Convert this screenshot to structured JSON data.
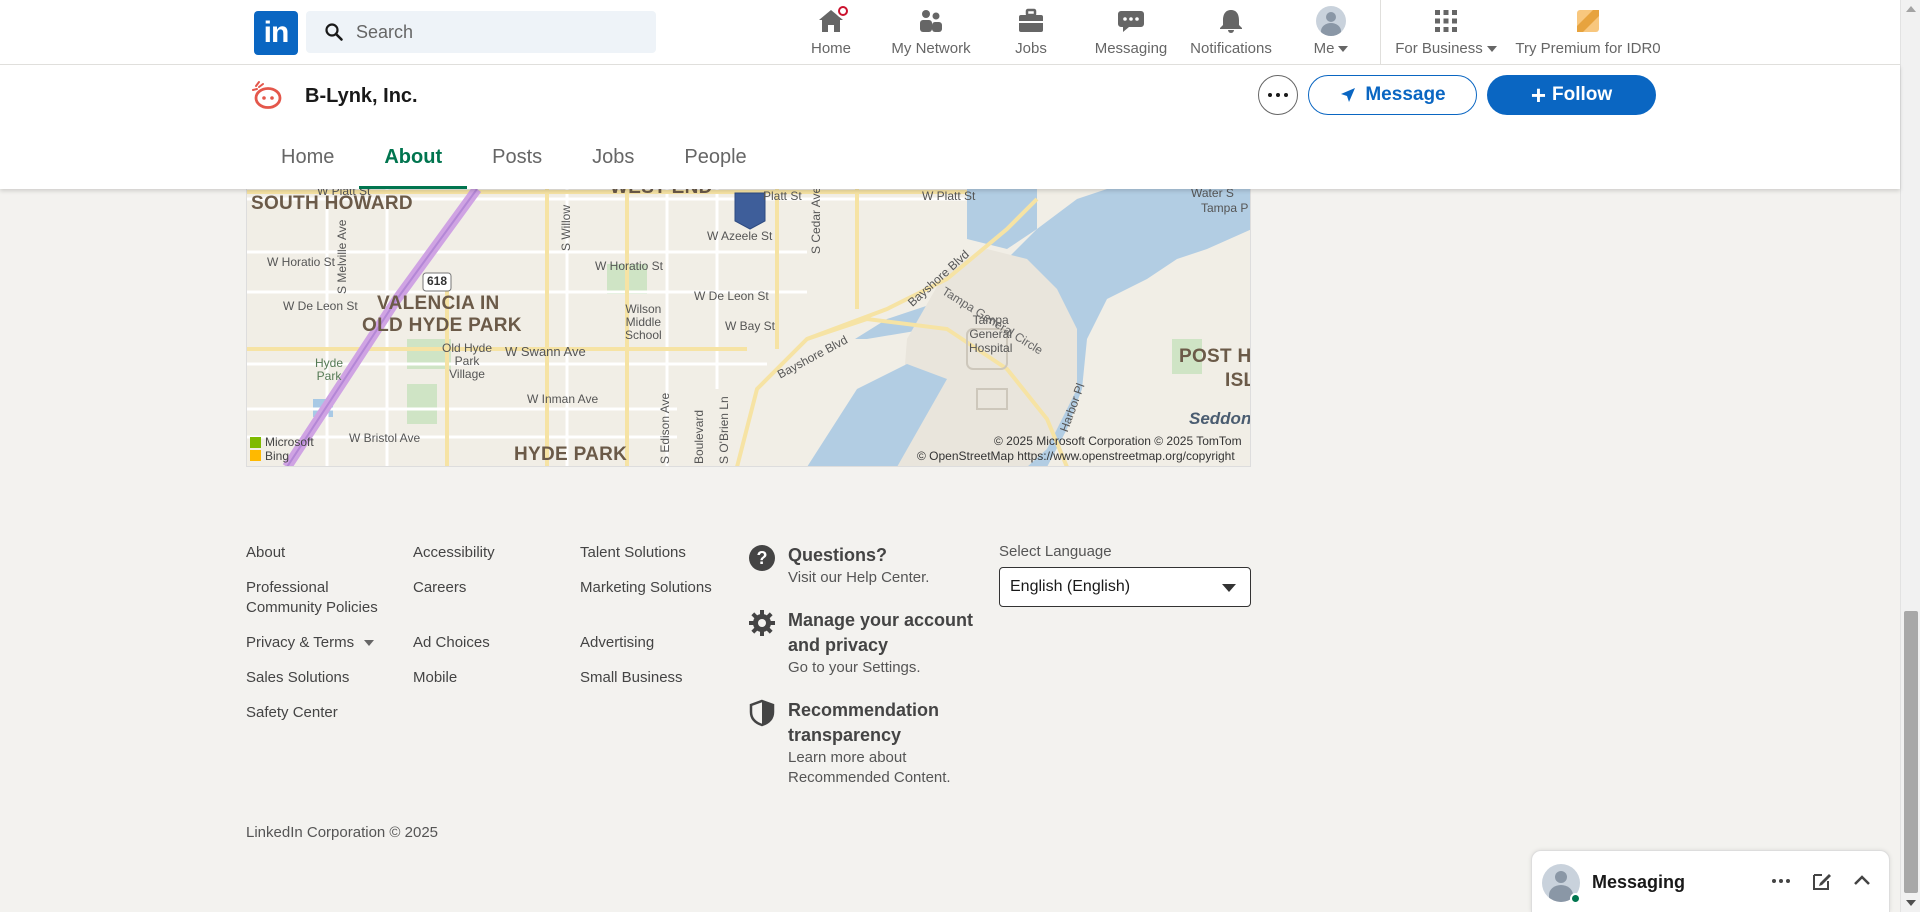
{
  "nav": {
    "search_placeholder": "Search",
    "items": [
      {
        "label": "Home",
        "icon": "home-icon"
      },
      {
        "label": "My Network",
        "icon": "network-icon"
      },
      {
        "label": "Jobs",
        "icon": "briefcase-icon"
      },
      {
        "label": "Messaging",
        "icon": "chat-icon"
      },
      {
        "label": "Notifications",
        "icon": "bell-icon"
      },
      {
        "label": "Me",
        "icon": "avatar"
      },
      {
        "label": "For Business",
        "icon": "grid-icon"
      },
      {
        "label": "Try Premium for IDR0",
        "icon": "premium-icon"
      }
    ],
    "logo_text": "in",
    "home_badge": true
  },
  "company": {
    "name": "B-Lynk, Inc.",
    "message_label": "Message",
    "follow_label": "Follow",
    "tabs": [
      "Home",
      "About",
      "Posts",
      "Jobs",
      "People"
    ],
    "active_tab": "About"
  },
  "map": {
    "labels": {
      "south_howard": "SOUTH HOWARD",
      "west_end": "WEST END",
      "valencia_1": "VALENCIA IN",
      "valencia_2": "OLD HYDE PARK",
      "hyde_park": "HYDE PARK",
      "post_h": "POST H",
      "isl": "ISL",
      "seddon": "Seddon",
      "old_hyde_village": "Old Hyde\nPark\nVillage",
      "wilson_school": "Wilson\nMiddle\nSchool",
      "tampa_general": "Tampa\nGeneral\nHospital",
      "tampa_general_circle": "Tampa General Circle",
      "hyde_park_small": "Hyde\nPark",
      "w_platt_st": "W Platt St",
      "w_platt_st_2": "W Platt St",
      "w_horatio_st": "W Horatio St",
      "w_horatio_st_2": "W Horatio St",
      "w_de_leon_st": "W De Leon St",
      "w_de_leon_st_2": "W De Leon St",
      "w_azeele_st": "W Azeele St",
      "w_bay_st": "W Bay St",
      "w_swann_ave": "W Swann Ave",
      "w_inman_ave": "W Inman Ave",
      "w_bristol_ave": "W Bristol Ave",
      "bayshore_blvd": "Bayshore Blvd",
      "bayshore_blvd_2": "Bayshore Blvd",
      "s_melville_ave": "S Melville Ave",
      "s_willow": "S Willow",
      "s_cedar_ave": "S Cedar Ave",
      "s_edison_ave": "S Edison Ave",
      "s_obrien_ln": "S O'Brien Ln",
      "boulevard": "Boulevard",
      "route_618": "618",
      "tampa_p": "Tampa P",
      "water_s": "Water S",
      "harbor_pl": "Harbor Pl",
      "platt_st_fragment": "Platt St"
    },
    "attribution_1": "© 2025 Microsoft Corporation © 2025 TomTom",
    "attribution_2": "© OpenStreetMap https://www.openstreetmap.org/copyright",
    "brand_1": "Microsoft",
    "brand_2": "Bing"
  },
  "footer": {
    "col1": [
      "About",
      "Professional Community Policies",
      "Privacy & Terms",
      "Sales Solutions",
      "Safety Center"
    ],
    "col2": [
      "Accessibility",
      "Careers",
      "Ad Choices",
      "Mobile"
    ],
    "col3": [
      "Talent Solutions",
      "Marketing Solutions",
      "Advertising",
      "Small Business"
    ],
    "help": [
      {
        "title": "Questions?",
        "sub": "Visit our Help Center.",
        "icon": "question-icon"
      },
      {
        "title": "Manage your account and privacy",
        "sub": "Go to your Settings.",
        "icon": "gear-icon"
      },
      {
        "title": "Recommendation transparency",
        "sub": "Learn more about Recommended Content.",
        "icon": "shield-icon"
      }
    ],
    "language_label": "Select Language",
    "language_value": "English (English)",
    "copyright": "LinkedIn Corporation © 2025"
  },
  "messaging": {
    "title": "Messaging"
  },
  "colors": {
    "brand": "#0a66c2",
    "active_tab": "#01754f",
    "page_bg": "#f3f2ef",
    "water": "#b2cde3"
  }
}
